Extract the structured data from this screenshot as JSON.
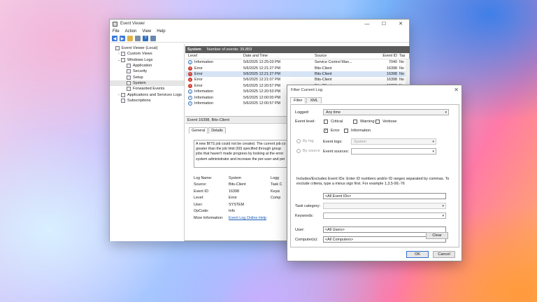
{
  "window": {
    "title": "Event Viewer",
    "menu": [
      "File",
      "Action",
      "View",
      "Help"
    ]
  },
  "tree": [
    {
      "label": "Event Viewer (Local)",
      "indent": 0,
      "twisty": "",
      "selected": false
    },
    {
      "label": "Custom Views",
      "indent": 1,
      "twisty": "›",
      "selected": false
    },
    {
      "label": "Windows Logs",
      "indent": 1,
      "twisty": "⌄",
      "selected": false
    },
    {
      "label": "Application",
      "indent": 2,
      "twisty": "",
      "selected": false
    },
    {
      "label": "Security",
      "indent": 2,
      "twisty": "",
      "selected": false
    },
    {
      "label": "Setup",
      "indent": 2,
      "twisty": "",
      "selected": false
    },
    {
      "label": "System",
      "indent": 2,
      "twisty": "",
      "selected": true
    },
    {
      "label": "Forwarded Events",
      "indent": 2,
      "twisty": "",
      "selected": false
    },
    {
      "label": "Applications and Services Logs",
      "indent": 1,
      "twisty": "›",
      "selected": false
    },
    {
      "label": "Subscriptions",
      "indent": 1,
      "twisty": "",
      "selected": false
    }
  ],
  "list": {
    "log_name": "System",
    "count_text": "Number of events: 39,859",
    "columns": {
      "level": "Level",
      "date": "Date and Time",
      "source": "Source",
      "id": "Event ID",
      "task": "Tas"
    },
    "rows": [
      {
        "level": "Information",
        "date": "5/6/2025 12:25:03 PM",
        "source": "Service Control Man...",
        "id": "7040",
        "task": "No",
        "kind": "info",
        "selected": false
      },
      {
        "level": "Error",
        "date": "5/6/2025 12:21:27 PM",
        "source": "Bits-Client",
        "id": "16398",
        "task": "No",
        "kind": "err",
        "selected": false
      },
      {
        "level": "Error",
        "date": "5/6/2025 12:21:27 PM",
        "source": "Bits-Client",
        "id": "16398",
        "task": "No",
        "kind": "err",
        "selected": true
      },
      {
        "level": "Error",
        "date": "5/6/2025 12:21:07 PM",
        "source": "Bits-Client",
        "id": "16398",
        "task": "No",
        "kind": "err",
        "selected": false
      },
      {
        "level": "Error",
        "date": "5/6/2025 12:20:57 PM",
        "source": "Bits-Client",
        "id": "16398",
        "task": "No",
        "kind": "err",
        "selected": false
      },
      {
        "level": "Information",
        "date": "5/6/2025 12:20:53 PM",
        "source": "",
        "id": "",
        "task": "",
        "kind": "info",
        "selected": false
      },
      {
        "level": "Information",
        "date": "5/6/2025 12:00:00 PM",
        "source": "",
        "id": "",
        "task": "",
        "kind": "info",
        "selected": false
      },
      {
        "level": "Information",
        "date": "5/6/2025 12:00:57 PM",
        "source": "",
        "id": "",
        "task": "",
        "kind": "info",
        "selected": false
      }
    ]
  },
  "detail": {
    "header": "Event 16398, Bits-Client",
    "tabs": [
      "General",
      "Details"
    ],
    "description_lines": [
      "A new BITS job could not be created. The current job co",
      "greater than the job limit (60) specified through group",
      "jobs that haven't made progress by looking at the error",
      "system administrator and increase the per-user and per"
    ],
    "props": [
      {
        "k": "Log Name:",
        "v": "System",
        "link": false
      },
      {
        "k": "Source:",
        "v": "Bits-Client",
        "link": false
      },
      {
        "k": "Event ID:",
        "v": "16398",
        "link": false
      },
      {
        "k": "Level:",
        "v": "Error",
        "link": false
      },
      {
        "k": "User:",
        "v": "SYSTEM",
        "link": false
      },
      {
        "k": "OpCode:",
        "v": "Info",
        "link": false
      },
      {
        "k": "More Information:",
        "v": "Event Log Online Help",
        "link": true
      }
    ],
    "side_keys": [
      "Logg",
      "Task C",
      "Keyw",
      "Comp"
    ]
  },
  "dialog": {
    "title": "Filter Current Log",
    "tabs": [
      "Filter",
      "XML"
    ],
    "logged_label": "Logged:",
    "logged_value": "Any time",
    "event_level_label": "Event level:",
    "levels": {
      "critical": "Critical",
      "warning": "Warning",
      "verbose": "Verbose",
      "error": "Error",
      "information": "Information"
    },
    "by_log": "By log",
    "by_source": "By source",
    "event_logs_label": "Event logs:",
    "event_logs_value": "System",
    "event_sources_label": "Event sources:",
    "help_text": "Includes/Excludes Event IDs: Enter ID numbers and/or ID ranges separated by commas. To exclude criteria, type a minus sign first. For example 1,3,5-99,-76",
    "event_ids_value": "<All Event IDs>",
    "task_category_label": "Task category:",
    "keywords_label": "Keywords:",
    "user_label": "User:",
    "user_value": "<All Users>",
    "computers_label": "Computer(s):",
    "computers_value": "<All Computers>",
    "clear": "Clear",
    "ok": "OK",
    "cancel": "Cancel"
  }
}
